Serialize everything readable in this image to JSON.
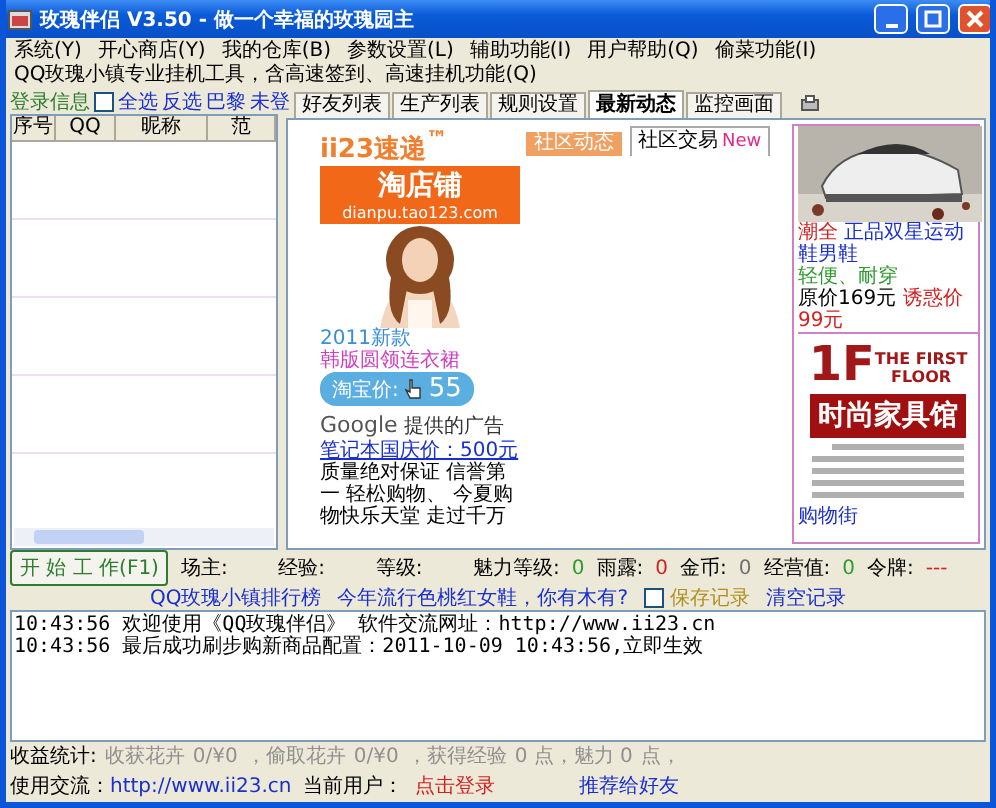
{
  "window": {
    "title": "玫瑰伴侣 V3.50 - 做一个幸福的玫瑰园主"
  },
  "menu": [
    "系统(Y)",
    "开心商店(Y)",
    "我的仓库(B)",
    "参数设置(L)",
    "辅助功能(I)",
    "用户帮助(Q)",
    "偷菜功能(I)",
    "QQ玫瑰小镇专业挂机工具，含高速签到、高速挂机功能(Q)"
  ],
  "login_panel": {
    "label": "登录信息",
    "select_all": {
      "checked": false
    },
    "links": [
      "全选",
      "反选",
      "巴黎",
      "未登"
    ],
    "columns": [
      "序号",
      "QQ",
      "昵称",
      "范"
    ]
  },
  "browser": {
    "tabs": [
      {
        "label": "好友列表",
        "selected": false
      },
      {
        "label": "生产列表",
        "selected": false
      },
      {
        "label": "规则设置",
        "selected": false
      },
      {
        "label": "最新动态",
        "selected": true
      },
      {
        "label": "监控画面",
        "selected": false
      }
    ],
    "ads": {
      "brand": "ii23速递",
      "tm": "™",
      "community_tab": "社区动态",
      "trade_tab": "社区交易",
      "new_badge": "New",
      "shop": {
        "title": "淘店铺",
        "url": "dianpu.tao123.com",
        "promo": [
          "2011新款",
          "韩版圆领连衣裙"
        ],
        "price_label": "淘宝价:",
        "price": "55"
      },
      "google": {
        "logo": "Google",
        "caption": "提供的广告",
        "title": "笔记本国庆价：500元",
        "body": "质量绝对保证 信誉第一 轻松购物、 今夏购物快乐天堂 走过千万"
      },
      "shoe": {
        "brand": "潮全",
        "title": "正品双星运动鞋男鞋",
        "desc": "轻便、耐穿",
        "old_price": "原价169元",
        "new_price": "诱惑价99元"
      },
      "floor": {
        "number": "1F",
        "line1": "THE FIRST",
        "line2": "FLOOR",
        "banner": "时尚家具馆"
      },
      "more_link": "购物街"
    }
  },
  "toolbar": {
    "start_button": "开 始 工 作(F1)",
    "labels": [
      "场主:",
      "经验:",
      "等级:"
    ],
    "stats": [
      {
        "label": "魅力等级:",
        "value": "0",
        "color": "#2e9a2e"
      },
      {
        "label": "雨露:",
        "value": "0",
        "color": "#d42020"
      },
      {
        "label": "金币:",
        "value": "0",
        "color": "#707070"
      },
      {
        "label": "经营值:",
        "value": "0",
        "color": "#2e9a2e"
      },
      {
        "label": "令牌:",
        "value": "---",
        "color": "#d42020"
      }
    ]
  },
  "links": [
    "QQ玫瑰小镇排行榜",
    "今年流行色桃红女鞋，你有木有?"
  ],
  "save_log": {
    "label": "保存记录",
    "checked": false
  },
  "clear_link": "清空记录",
  "log": [
    "10:43:56 欢迎使用《QQ玫瑰伴侣》 软件交流网址：http://www.ii23.cn",
    "10:43:56 最后成功刷步购新商品配置：2011-10-09 10:43:56,立即生效"
  ],
  "stats": {
    "label": "收益统计:",
    "parts": [
      "收获花卉",
      "0/¥0",
      "，偷取花卉",
      "0/¥0",
      "，获得经验",
      "0 点，魅力 0",
      "点，"
    ]
  },
  "status": {
    "site_label": "使用交流：",
    "site": "http://www.ii23.cn",
    "user_label": "当前用户：",
    "login_link": "点击登录",
    "recommend": "推荐给好友"
  }
}
